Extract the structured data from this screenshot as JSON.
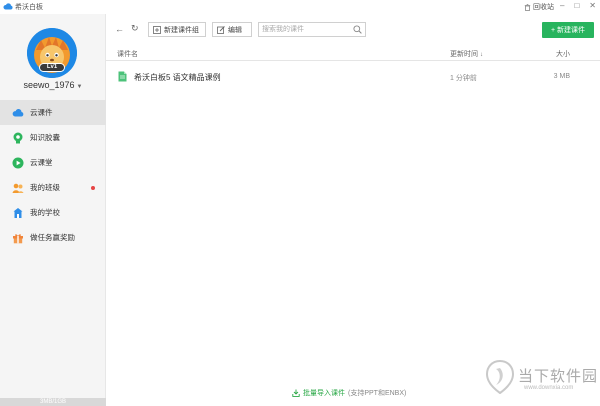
{
  "titlebar": {
    "app_name": "希沃白板",
    "recycle_bin": "回收站"
  },
  "user": {
    "username": "seewo_1976",
    "level": "Lv1"
  },
  "sidebar": {
    "items": [
      {
        "label": "云课件",
        "icon": "cloud-icon",
        "active": true
      },
      {
        "label": "知识胶囊",
        "icon": "capsule-icon"
      },
      {
        "label": "云课堂",
        "icon": "play-circle-icon"
      },
      {
        "label": "我的班级",
        "icon": "people-icon",
        "badge": true
      },
      {
        "label": "我的学校",
        "icon": "school-icon"
      },
      {
        "label": "做任务赢奖励",
        "icon": "gift-icon"
      }
    ],
    "storage": "3MB/1GB"
  },
  "toolbar": {
    "new_group": "新建课件组",
    "edit": "编辑",
    "search_placeholder": "搜索我的课件",
    "new_course": "新建课件"
  },
  "table": {
    "columns": {
      "name": "课件名",
      "updated": "更新时间",
      "size": "大小"
    },
    "rows": [
      {
        "name": "希沃白板5 语文精品课例",
        "updated": "1 分钟前",
        "size": "3 MB"
      }
    ]
  },
  "footer": {
    "import_link": "批量导入课件",
    "import_hint": "(支持PPT和ENBX)"
  },
  "watermark": {
    "text": "当下软件园",
    "url": "www.downxia.com"
  },
  "colors": {
    "accent_green": "#28b45e",
    "avatar_blue": "#1e88e5",
    "notify_red": "#e64545"
  }
}
